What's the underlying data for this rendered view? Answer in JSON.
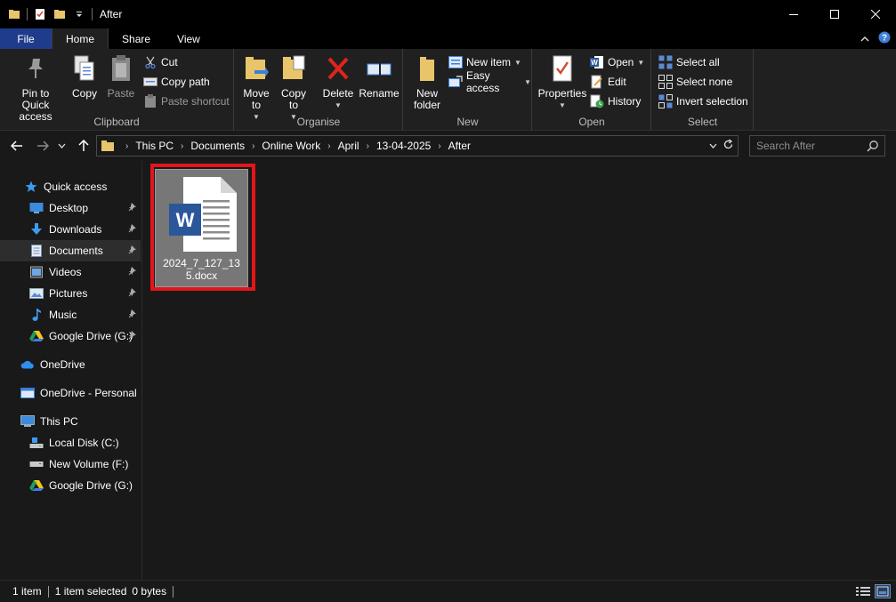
{
  "window": {
    "title": "After"
  },
  "ribbon_tabs": [
    {
      "label": "File"
    },
    {
      "label": "Home"
    },
    {
      "label": "Share"
    },
    {
      "label": "View"
    }
  ],
  "ribbon": {
    "clipboard": {
      "label": "Clipboard",
      "pin": "Pin to Quick access",
      "copy": "Copy",
      "paste": "Paste",
      "cut": "Cut",
      "copy_path": "Copy path",
      "paste_shortcut": "Paste shortcut"
    },
    "organise": {
      "label": "Organise",
      "move_to": "Move to",
      "copy_to": "Copy to",
      "delete": "Delete",
      "rename": "Rename"
    },
    "new": {
      "label": "New",
      "new_folder": "New folder",
      "new_item": "New item",
      "easy_access": "Easy access"
    },
    "open": {
      "label": "Open",
      "properties": "Properties",
      "open": "Open",
      "edit": "Edit",
      "history": "History"
    },
    "select": {
      "label": "Select",
      "select_all": "Select all",
      "select_none": "Select none",
      "invert_selection": "Invert selection"
    }
  },
  "address": {
    "crumbs": [
      "This PC",
      "Documents",
      "Online Work",
      "April",
      "13-04-2025",
      "After"
    ]
  },
  "search": {
    "placeholder": "Search After"
  },
  "nav": {
    "quick_access": "Quick access",
    "items": [
      {
        "label": "Desktop"
      },
      {
        "label": "Downloads"
      },
      {
        "label": "Documents"
      },
      {
        "label": "Videos"
      },
      {
        "label": "Pictures"
      },
      {
        "label": "Music"
      },
      {
        "label": "Google Drive (G:)"
      }
    ],
    "onedrive": "OneDrive",
    "onedrive_personal": "OneDrive - Personal",
    "this_pc": "This PC",
    "drives": [
      {
        "label": "Local Disk (C:)"
      },
      {
        "label": "New Volume (F:)"
      },
      {
        "label": "Google Drive (G:)"
      }
    ]
  },
  "files": [
    {
      "name": "2024_7_127_135.docx",
      "type": "word-document-icon"
    }
  ],
  "status": {
    "count": "1 item",
    "selected": "1 item selected",
    "size": "0 bytes"
  },
  "colors": {
    "accent": "#1f3c8c",
    "highlight": "#e3151a",
    "selection": "#777777"
  }
}
